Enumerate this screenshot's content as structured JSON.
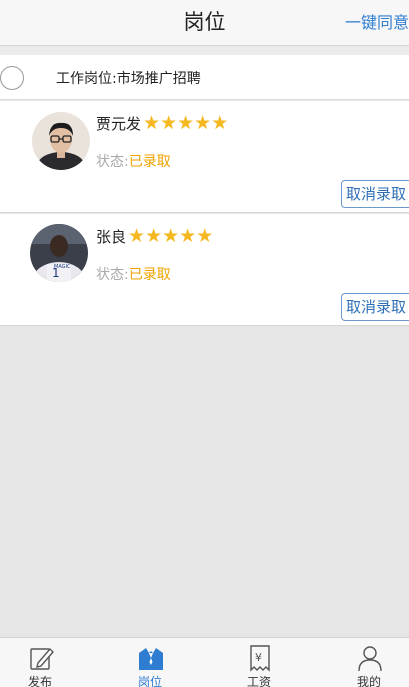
{
  "header": {
    "title": "岗位",
    "action_label": "一键同意"
  },
  "job": {
    "title": "工作岗位:市场推广招聘"
  },
  "candidates": [
    {
      "name": "贾元发",
      "rating": 5,
      "status_label": "状态:",
      "status_value": "已录取",
      "cancel_label": "取消录取"
    },
    {
      "name": "张良",
      "rating": 5,
      "status_label": "状态:",
      "status_value": "已录取",
      "cancel_label": "取消录取"
    }
  ],
  "tabbar": {
    "items": [
      {
        "label": "发布",
        "icon": "edit-icon"
      },
      {
        "label": "岗位",
        "icon": "uniform-icon"
      },
      {
        "label": "工资",
        "icon": "receipt-yen-icon"
      },
      {
        "label": "我的",
        "icon": "person-icon"
      }
    ],
    "active_index": 1
  },
  "colors": {
    "accent": "#2f7dd0",
    "star": "#f5b820",
    "status_value": "#f0a200"
  }
}
